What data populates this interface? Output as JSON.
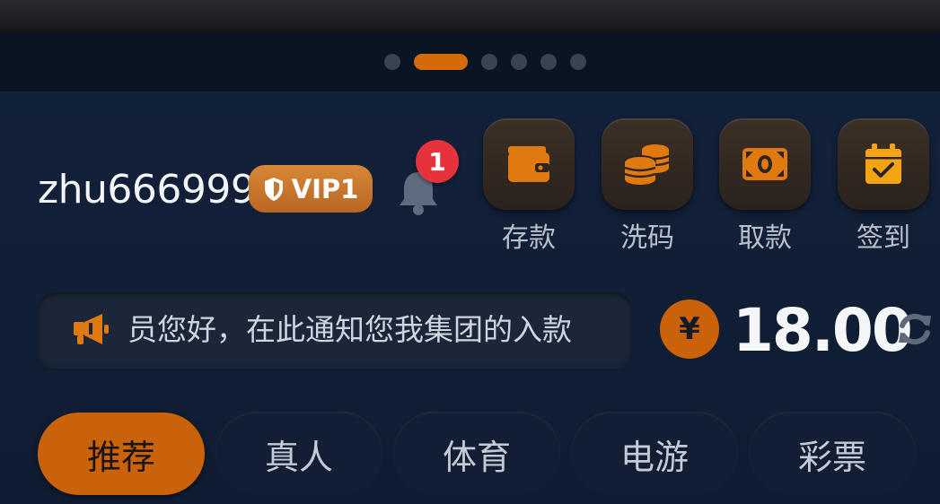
{
  "carousel": {
    "slide_count": 6,
    "active_index": 1
  },
  "user": {
    "username": "zhu666999",
    "vip_label": "VIP1",
    "notification_count": "1"
  },
  "actions": [
    {
      "label": "存款",
      "icon": "wallet-icon"
    },
    {
      "label": "洗码",
      "icon": "coins-icon"
    },
    {
      "label": "取款",
      "icon": "cash-icon"
    },
    {
      "label": "签到",
      "icon": "calendar-check-icon"
    }
  ],
  "notice": {
    "text": "员您好，在此通知您我集团的入款"
  },
  "balance": {
    "currency_symbol": "¥",
    "amount": "18.00"
  },
  "tabs": [
    {
      "label": "推荐",
      "active": true
    },
    {
      "label": "真人",
      "active": false
    },
    {
      "label": "体育",
      "active": false
    },
    {
      "label": "电游",
      "active": false
    },
    {
      "label": "彩票",
      "active": false
    }
  ],
  "colors": {
    "accent": "#c9620a",
    "background": "#0f1b2d",
    "badge": "#e6323a"
  }
}
